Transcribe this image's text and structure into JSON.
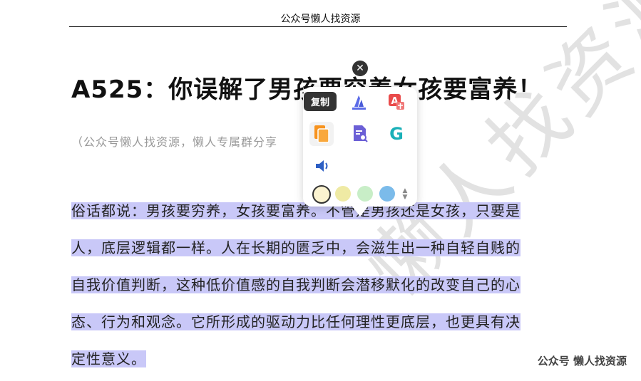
{
  "header": {
    "title": "公众号懒人找资源"
  },
  "article": {
    "title": "A525：你误解了男孩要穷养女孩要富养！",
    "subtitle": "（公众号懒人找资源，懒人专属群分享"
  },
  "paragraph": {
    "lines": [
      "俗话都说：男孩要穷养，女孩要富养。不管是男孩还是女孩，只要是",
      "人，底层逻辑都一样。人在长期的匮乏中，会滋生出一种自轻自贱的",
      "自我价值判断，这种低价值感的自我判断会潜移默化的改变自己的心",
      "态、行为和观念。它所形成的驱动力比任何理性更底层，也更具有决",
      "定性意义。"
    ]
  },
  "watermark": {
    "text": "懒人找资源"
  },
  "corner_brand": {
    "text": "公众号 懒人找资源"
  },
  "popup": {
    "tooltip": "复制",
    "close_icon": "close-icon",
    "tools": [
      {
        "name": "copy-icon",
        "color": "#f7931e"
      },
      {
        "name": "highlighter-icon",
        "color": "#5b6be8"
      },
      {
        "name": "translate-icon",
        "color": "#e94b4b"
      },
      {
        "name": "search-document-icon",
        "color": "#6b5fd6"
      },
      {
        "name": "grammar-g-icon",
        "color": "#1ab0b8"
      },
      {
        "name": "speaker-icon",
        "color": "#2d5fc4"
      }
    ],
    "colors": [
      "#fbf3d0",
      "#efeaa4",
      "#c8eec7",
      "#7bbbea"
    ],
    "selected_color": "#fbf3d0"
  }
}
